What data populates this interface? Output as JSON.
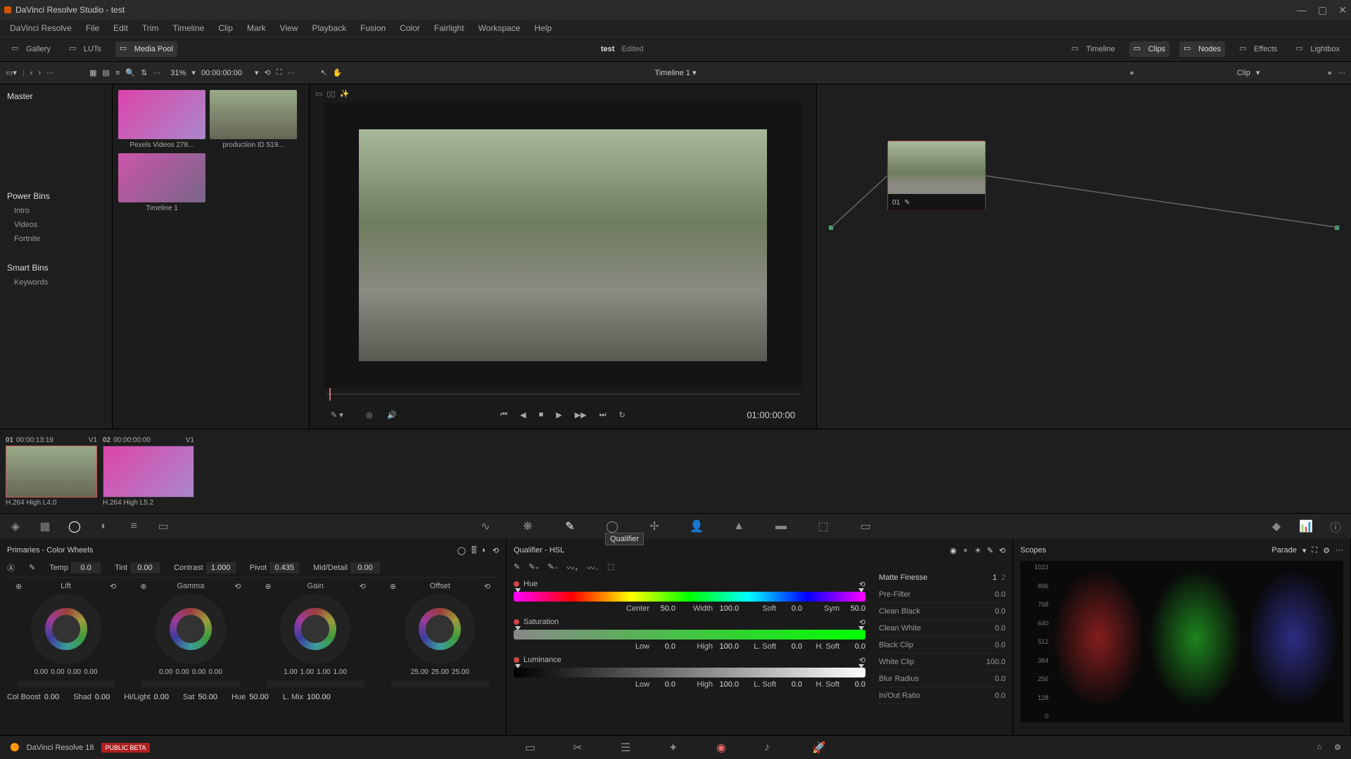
{
  "title": "DaVinci Resolve Studio - test",
  "menu": [
    "DaVinci Resolve",
    "File",
    "Edit",
    "Trim",
    "Timeline",
    "Clip",
    "Mark",
    "View",
    "Playback",
    "Fusion",
    "Color",
    "Fairlight",
    "Workspace",
    "Help"
  ],
  "tabs": {
    "left": [
      {
        "n": "gallery",
        "l": "Gallery"
      },
      {
        "n": "luts",
        "l": "LUTs"
      },
      {
        "n": "mediapool",
        "l": "Media Pool"
      }
    ],
    "center": {
      "project": "test",
      "status": "Edited"
    },
    "right": [
      {
        "n": "timeline",
        "l": "Timeline"
      },
      {
        "n": "clips",
        "l": "Clips"
      },
      {
        "n": "nodes",
        "l": "Nodes"
      },
      {
        "n": "effects",
        "l": "Effects"
      },
      {
        "n": "lightbox",
        "l": "Lightbox"
      }
    ]
  },
  "toolrow": {
    "zoom": "31%",
    "timeline": "Timeline 1",
    "tc": "00:00:00:00"
  },
  "sidebar": {
    "master": "Master",
    "powerbins": {
      "hd": "Power Bins",
      "items": [
        "Intro",
        "Videos",
        "Fortnite"
      ]
    },
    "smartbins": {
      "hd": "Smart Bins",
      "items": [
        "Keywords"
      ]
    }
  },
  "media": [
    {
      "n": "Pexels Videos 278..."
    },
    {
      "n": "production ID 519..."
    },
    {
      "n": "Timeline 1"
    }
  ],
  "transport": {
    "tc": "01:00:00:00"
  },
  "nodes": {
    "mode": "Clip",
    "node": "01"
  },
  "clips": [
    {
      "num": "01",
      "tc": "00:00:13:19",
      "trk": "V1",
      "name": "H.264 High L4.0",
      "sel": true
    },
    {
      "num": "02",
      "tc": "00:00:00:00",
      "trk": "V1",
      "name": "H.264 High L5.2",
      "sel": false
    }
  ],
  "primaries": {
    "title": "Primaries - Color Wheels",
    "globals": [
      {
        "l": "Temp",
        "v": "0.0"
      },
      {
        "l": "Tint",
        "v": "0.00"
      },
      {
        "l": "Contrast",
        "v": "1.000"
      },
      {
        "l": "Pivot",
        "v": "0.435"
      },
      {
        "l": "Mid/Detail",
        "v": "0.00"
      }
    ],
    "wheels": [
      {
        "name": "Lift",
        "vals": [
          "0.00",
          "0.00",
          "0.00",
          "0.00"
        ]
      },
      {
        "name": "Gamma",
        "vals": [
          "0.00",
          "0.00",
          "0.00",
          "0.00"
        ]
      },
      {
        "name": "Gain",
        "vals": [
          "1.00",
          "1.00",
          "1.00",
          "1.00"
        ]
      },
      {
        "name": "Offset",
        "vals": [
          "25.00",
          "25.00",
          "25.00"
        ]
      }
    ],
    "adjust": [
      {
        "l": "Col Boost",
        "v": "0.00"
      },
      {
        "l": "Shad",
        "v": "0.00"
      },
      {
        "l": "Hi/Light",
        "v": "0.00"
      },
      {
        "l": "Sat",
        "v": "50.00"
      },
      {
        "l": "Hue",
        "v": "50.00"
      },
      {
        "l": "L. Mix",
        "v": "100.00"
      }
    ]
  },
  "qualifier": {
    "title": "Qualifier - HSL",
    "tooltip": "Qualifier",
    "hue": {
      "name": "Hue",
      "center": "50.0",
      "width": "100.0",
      "soft": "0.0",
      "sym": "50.0"
    },
    "sat": {
      "name": "Saturation",
      "low": "0.0",
      "high": "100.0",
      "lsoft": "0.0",
      "hsoft": "0.0"
    },
    "lum": {
      "name": "Luminance",
      "low": "0.0",
      "high": "100.0",
      "lsoft": "0.0",
      "hsoft": "0.0"
    },
    "finesse": {
      "title": "Matte Finesse",
      "page1": "1",
      "page2": "2",
      "rows": [
        {
          "l": "Pre-Filter",
          "v": "0.0"
        },
        {
          "l": "Clean Black",
          "v": "0.0"
        },
        {
          "l": "Clean White",
          "v": "0.0"
        },
        {
          "l": "Black Clip",
          "v": "0.0"
        },
        {
          "l": "White Clip",
          "v": "100.0"
        },
        {
          "l": "Blur Radius",
          "v": "0.0"
        },
        {
          "l": "In/Out Ratio",
          "v": "0.0"
        }
      ]
    }
  },
  "scopes": {
    "title": "Scopes",
    "mode": "Parade",
    "ticks": [
      "1023",
      "896",
      "768",
      "640",
      "512",
      "384",
      "256",
      "128",
      "0"
    ]
  },
  "footer": {
    "version": "DaVinci Resolve 18",
    "badge": "PUBLIC BETA"
  }
}
